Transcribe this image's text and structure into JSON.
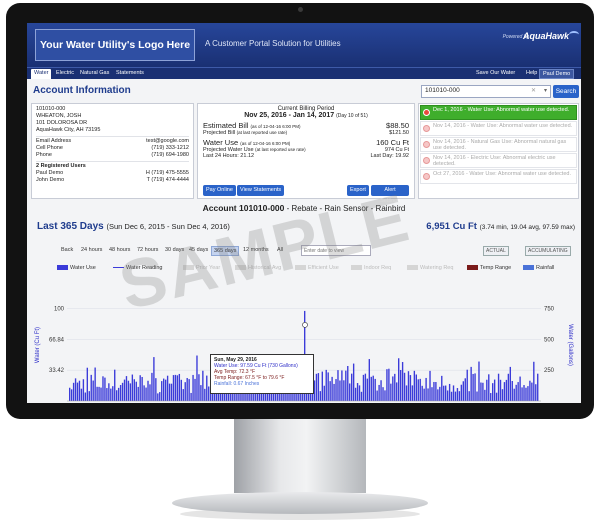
{
  "header": {
    "logo_text": "Your Water Utility's Logo Here",
    "tagline": "A Customer Portal Solution for Utilities",
    "powered_by": "Powered by",
    "brand": "AquaHawk"
  },
  "nav": {
    "tabs": [
      {
        "label": "Water"
      },
      {
        "label": "Electric"
      },
      {
        "label": "Natural Gas"
      },
      {
        "label": "Statements"
      }
    ],
    "right": {
      "save": "Save Our Water",
      "help": "Help",
      "user": "Paul Demo"
    }
  },
  "account": {
    "title": "Account Information",
    "search_value": "101010-000",
    "search_button": "Search",
    "id": "101010-000",
    "name": "WHEATON, JOSH",
    "address1": "101 DOLOROSA DR",
    "address2": "AquaHawk City, AH 73195",
    "email_label": "Email Address",
    "email": "test@google.com",
    "cell_label": "Cell Phone",
    "cell": "(719) 333-1212",
    "phone_label": "Phone",
    "phone": "(719) 694-1980",
    "registered_label": "2 Registered Users",
    "users": [
      {
        "name": "Paul Demo",
        "phone": "H (719) 475-5555"
      },
      {
        "name": "John Demo",
        "phone": "T (719) 474-4444"
      }
    ]
  },
  "billing": {
    "label": "Current Billing Period",
    "dates": "Nov 25, 2016 - Jan 14, 2017",
    "days": "(Day 10 of 51)",
    "est_bill_label": "Estimated Bill",
    "est_bill_as_of": "(as of 12-04-16 6:00 PM)",
    "est_bill_value": "$88.50",
    "proj_bill_label": "Projected Bill",
    "proj_bill_note": "(at last reported use rate)",
    "proj_bill_value": "$121.50",
    "water_use_label": "Water Use",
    "water_use_as_of": "(as of 12-04-16 6:00 PM)",
    "water_use_value": "160 Cu Ft",
    "proj_water_label": "Projected Water Use",
    "proj_water_note": "(at last reported use rate)",
    "proj_water_value": "974 Cu Ft",
    "last24_label": "Last 24 Hours: 21.12",
    "lastday_label": "Last Day: 19.92",
    "buttons": {
      "pay": "Pay Online",
      "statements": "View Statements",
      "export": "Export",
      "alert": "Alert Settings"
    }
  },
  "alerts": [
    {
      "date": "Dec 1, 2016",
      "text": "Water Use: Abnormal water use detected."
    },
    {
      "date": "Nov 14, 2016",
      "text": "Water Use: Abnormal water use detected."
    },
    {
      "date": "Nov 14, 2016",
      "text": "Natural Gas Use: Abnormal natural gas use detected."
    },
    {
      "date": "Nov 14, 2016",
      "text": "Electric Use: Abnormal electric use detected."
    },
    {
      "date": "Oct 27, 2016",
      "text": "Water Use: Abnormal water use detected."
    }
  ],
  "account_line": {
    "bold": "Account 101010-000",
    "rest": " - Rebate - Rain Sensor - Rainbird"
  },
  "summary": {
    "title": "Last 365 Days",
    "range": "(Sun Dec 6, 2015 - Sun Dec 4, 2016)",
    "total": "6,951 Cu Ft",
    "total_detail": "(3.74 min, 19.04 avg, 97.59 max)"
  },
  "range_options": [
    "Back",
    "24 hours",
    "48 hours",
    "72 hours",
    "30 days",
    "45 days",
    "365 days",
    "12 months",
    "All"
  ],
  "range_selected": "365 days",
  "date_placeholder": "Enter date to view",
  "toggles": {
    "actual": "ACTUAL",
    "accumulating": "ACCUMULATING"
  },
  "watermark": "SAMPLE",
  "colors": {
    "water_use": "#3b3bd9",
    "temp_range": "#7a1a1a",
    "rainfall": "#4a72d8",
    "accent": "#2a63c9",
    "alert_green": "#3fae2c"
  },
  "tooltip": {
    "date": "Sun, May 29, 2016",
    "water": "Water Use: 97.59 Cu Ft (730 Gallons)",
    "temp": "Avg Temp: 72.3 °F",
    "range": "Temp Range: 67.5 °F to 79.6 °F",
    "rain": "Rainfall: 0.67 Inches"
  },
  "chart_data": {
    "type": "bar",
    "legend": [
      "Water Use",
      "Water Reading",
      "Prior Year",
      "Historical Avg",
      "Efficient Use",
      "Indoor Req",
      "Watering Req",
      "Temp Range",
      "Rainfall"
    ],
    "ylabel": "Water (Cu Ft)",
    "y2label": "Water (Gallons)",
    "yticks": [
      33.42,
      66.84,
      100
    ],
    "y2ticks": [
      250,
      500,
      750
    ],
    "ylim": [
      0,
      130
    ],
    "xlabel": "",
    "series": [
      {
        "name": "Water Use",
        "seed": 7,
        "count": 240,
        "peak_index": 120,
        "peak_value": 97.59
      }
    ]
  }
}
